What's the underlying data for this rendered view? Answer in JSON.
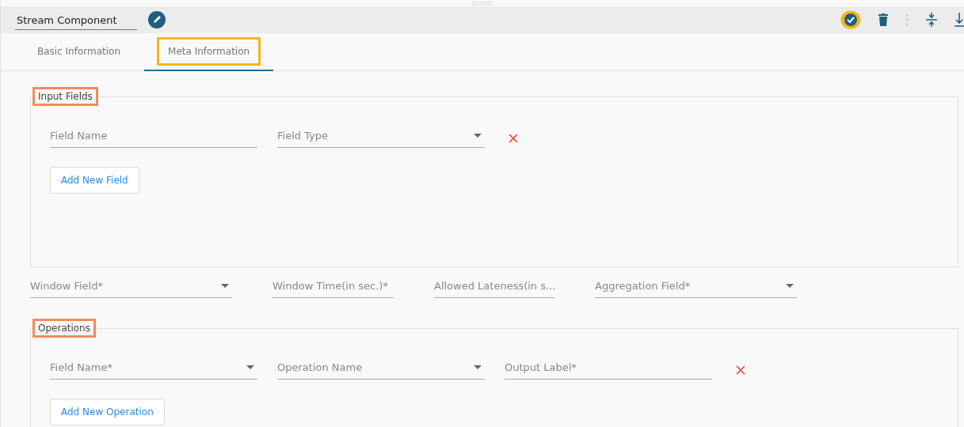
{
  "header": {
    "name": "Stream Component"
  },
  "tabs": [
    {
      "label": "Basic Information",
      "selected": false,
      "highlighted": false
    },
    {
      "label": "Meta Information",
      "selected": true,
      "highlighted": true
    }
  ],
  "input_fields": {
    "legend": "Input Fields",
    "rows": [
      [
        {
          "kind": "text",
          "placeholder": "Field Name"
        },
        {
          "kind": "select",
          "placeholder": "Field Type"
        }
      ]
    ],
    "button": "Add New Field"
  },
  "window_fields": [
    {
      "kind": "select",
      "placeholder": "Window Field*"
    },
    {
      "kind": "text",
      "placeholder": "Window Time(in sec.)*"
    },
    {
      "kind": "text",
      "placeholder": "Allowed Lateness(in s..."
    },
    {
      "kind": "select",
      "placeholder": "Aggregation Field*"
    }
  ],
  "operations": {
    "legend": "Operations",
    "rows": [
      [
        {
          "kind": "select",
          "placeholder": "Field Name*"
        },
        {
          "kind": "select",
          "placeholder": "Operation Name"
        },
        {
          "kind": "text",
          "placeholder": "Output Label*"
        }
      ]
    ],
    "button": "Add New Operation"
  }
}
